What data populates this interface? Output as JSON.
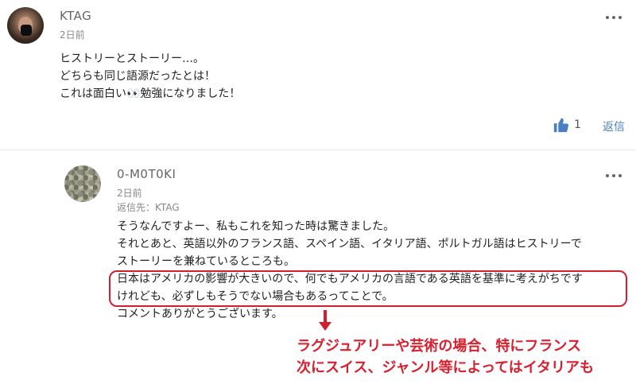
{
  "comments": [
    {
      "author": "KTAG",
      "time": "2日前",
      "lines": [
        "ヒストリーとストーリー…。",
        "どちらも同じ語源だったとは！",
        "これは面白い👀勉強になりました！"
      ],
      "likes": "1",
      "reply_label": "返信"
    },
    {
      "author": "0-M0T0KI",
      "time": "2日前",
      "reply_to": "返信先：KTAG",
      "lines": [
        "そうなんですよー、私もこれを知った時は驚きました。",
        "それとあと、英語以外のフランス語、スペイン語、イタリア語、ポルトガル語はヒストリーで",
        "ストーリーを兼ねているところも。",
        "日本はアメリカの影響が大きいので、何でもアメリカの言語である英語を基準に考えがちです",
        "けれども、必ずしもそうでない場合もあるってことで。",
        "コメントありがとうございます。"
      ]
    }
  ],
  "annotation": {
    "lines": [
      "ラグジュアリーや芸術の場合、特にフランス",
      "次にスイス、ジャンル等によってはイタリアも"
    ],
    "color": "#d91f2e"
  },
  "icons": {
    "more": "more-horizontal-icon",
    "like": "thumbs-up-icon",
    "arrow": "arrow-down-icon"
  },
  "colors": {
    "like_blue": "#4a7fc1",
    "highlight_red": "#d11f2f"
  }
}
